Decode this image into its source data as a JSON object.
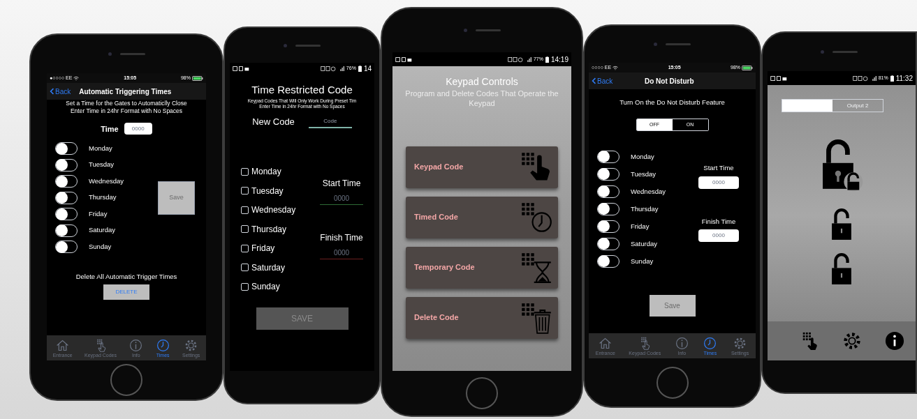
{
  "screens": [
    {
      "kind": "trigger_times",
      "status": {
        "carrier": "●○○○○ EE",
        "time": "15:05",
        "battery": "98%"
      },
      "back": "Back",
      "title": "Automatic Triggering Times",
      "instructions": [
        "Set a Time for the Gates to Automaticlly Close",
        "Enter Time in 24hr Format with No Spaces"
      ],
      "time_label": "Time",
      "time_placeholder": "0000",
      "days": [
        {
          "label": "Monday",
          "on": false
        },
        {
          "label": "Tuesday",
          "on": false
        },
        {
          "label": "Wednesday",
          "on": false
        },
        {
          "label": "Thursday",
          "on": false
        },
        {
          "label": "Friday",
          "on": false
        },
        {
          "label": "Saturday",
          "on": false
        },
        {
          "label": "Sunday",
          "on": false
        }
      ],
      "save_button": "Save",
      "delete_label": "Delete All Automatic Trigger Times",
      "delete_button": "DELETE",
      "tabs": [
        {
          "label": "Entrance",
          "selected": false
        },
        {
          "label": "Keypad Codes",
          "selected": false
        },
        {
          "label": "Info",
          "selected": false
        },
        {
          "label": "Times",
          "selected": true
        },
        {
          "label": "Settings",
          "selected": false
        }
      ]
    },
    {
      "kind": "restricted_code",
      "status": {
        "battery": "76%",
        "time": "14"
      },
      "title": "Time Restricted Code",
      "subtitle": [
        "Keypad Codes That Will Only Work During Preset Tim",
        "Enter Time in 24hr Format with No Spaces"
      ],
      "code_label": "New Code",
      "code_placeholder": "Code",
      "days": [
        {
          "label": "Monday",
          "checked": false
        },
        {
          "label": "Tuesday",
          "checked": false
        },
        {
          "label": "Wednesday",
          "checked": false
        },
        {
          "label": "Thursday",
          "checked": false
        },
        {
          "label": "Friday",
          "checked": false
        },
        {
          "label": "Saturday",
          "checked": false
        },
        {
          "label": "Sunday",
          "checked": false
        }
      ],
      "start_label": "Start Time",
      "start_placeholder": "0000",
      "finish_label": "Finish Time",
      "finish_placeholder": "0000",
      "save_button": "SAVE"
    },
    {
      "kind": "keypad_controls",
      "status": {
        "battery": "77%",
        "time": "14:19"
      },
      "title": "Keypad Controls",
      "subtitle": "Program and Delete Codes That Operate the Keypad",
      "buttons": [
        {
          "label": "Keypad Code",
          "kind": "hand"
        },
        {
          "label": "Timed Code",
          "kind": "clock"
        },
        {
          "label": "Temporary Code",
          "kind": "hourglass"
        },
        {
          "label": "Delete Code",
          "kind": "trash"
        }
      ]
    },
    {
      "kind": "do_not_disturb",
      "status": {
        "carrier": "○○○○ EE",
        "time": "15:05",
        "battery": "98%"
      },
      "back": "Back",
      "title": "Do Not Disturb",
      "feature_label": "Turn On the Do Not Disturb Feature",
      "segments": [
        {
          "label": "OFF",
          "selected": true
        },
        {
          "label": "ON",
          "selected": false
        }
      ],
      "days": [
        {
          "label": "Monday",
          "on": false
        },
        {
          "label": "Tuesday",
          "on": false
        },
        {
          "label": "Wednesday",
          "on": false
        },
        {
          "label": "Thursday",
          "on": false
        },
        {
          "label": "Friday",
          "on": false
        },
        {
          "label": "Saturday",
          "on": false
        },
        {
          "label": "Sunday",
          "on": false
        }
      ],
      "start_label": "Start Time",
      "start_placeholder": "0000",
      "finish_label": "Finish Time",
      "finish_placeholder": "0000",
      "save_button": "Save",
      "tabs": [
        {
          "label": "Entrance",
          "selected": false
        },
        {
          "label": "Keypad Codes",
          "selected": false
        },
        {
          "label": "Info",
          "selected": false
        },
        {
          "label": "Times",
          "selected": true
        },
        {
          "label": "Settings",
          "selected": false
        }
      ]
    },
    {
      "kind": "outputs",
      "status": {
        "battery": "81%",
        "time": "11:32"
      },
      "outputs": [
        {
          "selected": true
        },
        {
          "label": "Output 2",
          "selected": false
        }
      ]
    }
  ]
}
